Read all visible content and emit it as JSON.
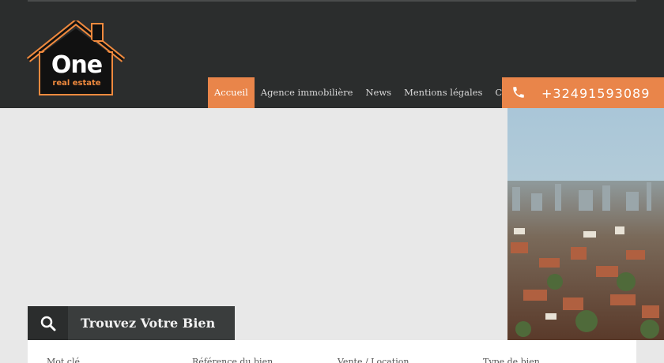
{
  "brand": {
    "name": "One",
    "tagline": "real estate",
    "accent": "#e9854a",
    "dark": "#2b2d2d"
  },
  "nav": {
    "items": [
      {
        "label": "Accueil",
        "active": true
      },
      {
        "label": "Agence immobilière",
        "active": false
      },
      {
        "label": "News",
        "active": false
      },
      {
        "label": "Mentions légales",
        "active": false
      },
      {
        "label": "Contact",
        "active": false
      }
    ]
  },
  "phone": {
    "icon": "phone-icon",
    "number": "+32491593089"
  },
  "search": {
    "icon": "search-icon",
    "title": "Trouvez Votre Bien",
    "fields": [
      {
        "label": "Mot clé"
      },
      {
        "label": "Référence du bien"
      },
      {
        "label": "Vente / Location"
      },
      {
        "label": "Type de bien"
      }
    ]
  }
}
